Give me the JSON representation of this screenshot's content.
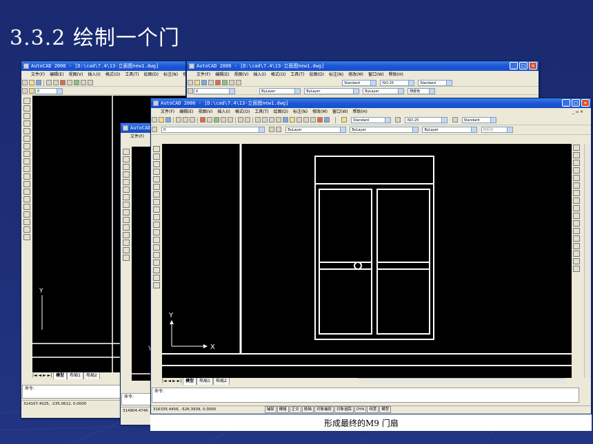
{
  "slide": {
    "title": "3.3.2 绘制一个门",
    "caption": "形成最终的M9 门扇"
  },
  "colors": {
    "slide_bg": "#1f2e73",
    "titlebar": "#1c56d6",
    "drawing_bg": "#000000",
    "drawing_lines": "#ffffff"
  },
  "main_window": {
    "title": "AutoCAD 2006 - [D:\\cad\\7.4\\13-立面图new1.dwg]",
    "menu": [
      "文件(F)",
      "编辑(E)",
      "视图(V)",
      "插入(I)",
      "格式(O)",
      "工具(T)",
      "绘图(D)",
      "标注(N)",
      "修改(M)",
      "窗口(W)",
      "帮助(H)"
    ],
    "text_style": "Standard",
    "dim_style": "ISO-25",
    "table_style": "Standard",
    "layer": "0",
    "color": "ByLayer",
    "linetype": "ByLayer",
    "lineweight": "ByLayer",
    "plot_style": "随颜色",
    "tabs": [
      "模型",
      "布局1",
      "布局2"
    ],
    "command_prompt": "命令:",
    "coordinates": "316335.4456, -526.3939, 0.0000",
    "status_buttons": [
      "捕捉",
      "栅格",
      "正交",
      "极轴",
      "对象捕捉",
      "对象追踪",
      "DYN",
      "线宽",
      "模型"
    ],
    "ucs_x": "X",
    "ucs_y": "Y"
  },
  "back_window_1": {
    "title": "AutoCAD 2006 - [D:\\cad\\7.4\\13-立面图new1.dwg]",
    "menu": [
      "文件(F)",
      "编辑(E)",
      "视图(V)",
      "插入(I)",
      "格式(O)",
      "工具(T)",
      "绘图(D)",
      "标注(N)",
      "修改"
    ],
    "coordinates": "314107.4025, -235.0612, 0.0000",
    "tabs": [
      "模型",
      "布局1",
      "布局2"
    ],
    "command_prompt": "命令:",
    "layer": "0"
  },
  "back_window_2": {
    "title": "AutoCAD 2006 - [D:\\cad\\7.4\\13-立面图new1.dwg]",
    "menu": [
      "文件(F)",
      "编辑(E)",
      "视图(V)",
      "插入(I)",
      "格式(O)",
      "工具(T)",
      "绘图(D)",
      "标注(N)",
      "修改(M)",
      "窗口(W)",
      "帮助(H)"
    ],
    "text_style": "Standard",
    "dim_style": "ISO-25",
    "table_style": "Standard",
    "layer": "0",
    "color": "ByLayer",
    "linetype": "ByLayer",
    "lineweight": "ByLayer",
    "plot_style": "随颜色"
  },
  "back_window_3": {
    "title": "AutoCAD",
    "menu": [
      "文件(F)"
    ],
    "coordinates": "314904.4745",
    "command_prompt": "命令:"
  }
}
